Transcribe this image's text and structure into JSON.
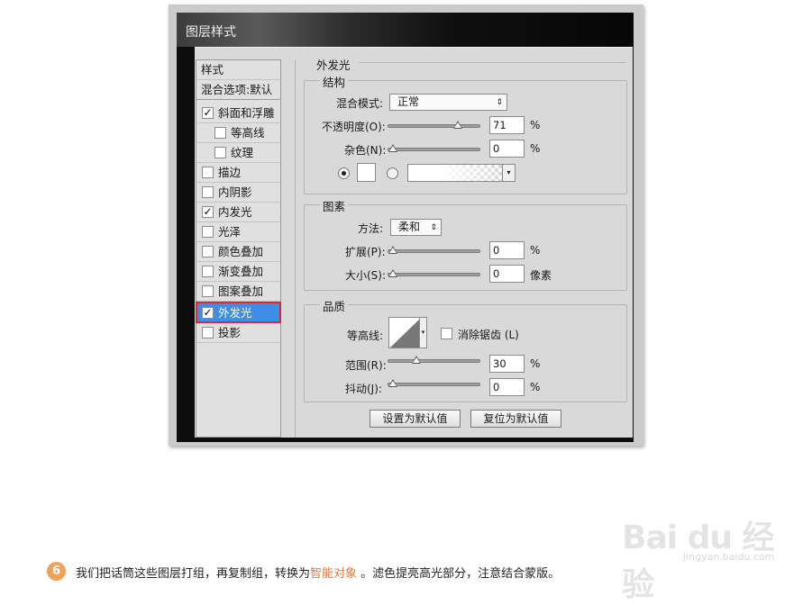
{
  "dialog": {
    "title": "图层样式"
  },
  "styles": {
    "header": "样式",
    "blend": "混合选项:默认",
    "items": [
      {
        "label": "斜面和浮雕",
        "checked": true
      },
      {
        "label": "等高线",
        "checked": false
      },
      {
        "label": "纹理",
        "checked": false
      },
      {
        "label": "描边",
        "checked": false
      },
      {
        "label": "内阴影",
        "checked": false
      },
      {
        "label": "内发光",
        "checked": true
      },
      {
        "label": "光泽",
        "checked": false
      },
      {
        "label": "颜色叠加",
        "checked": false
      },
      {
        "label": "渐变叠加",
        "checked": false
      },
      {
        "label": "图案叠加",
        "checked": false
      },
      {
        "label": "外发光",
        "checked": true
      },
      {
        "label": "投影",
        "checked": false
      }
    ]
  },
  "panel": {
    "title": "外发光",
    "structure": {
      "label": "结构",
      "blend_mode_label": "混合模式:",
      "blend_mode_value": "正常",
      "opacity_label": "不透明度(O):",
      "opacity_value": "71",
      "opacity_unit": "%",
      "noise_label": "杂色(N):",
      "noise_value": "0",
      "noise_unit": "%"
    },
    "elements": {
      "label": "图素",
      "method_label": "方法:",
      "method_value": "柔和",
      "spread_label": "扩展(P):",
      "spread_value": "0",
      "spread_unit": "%",
      "size_label": "大小(S):",
      "size_value": "0",
      "size_unit": "像素"
    },
    "quality": {
      "label": "品质",
      "contour_label": "等高线:",
      "antialias_label": "消除锯齿 (L)",
      "range_label": "范围(R):",
      "range_value": "30",
      "range_unit": "%",
      "jitter_label": "抖动(J):",
      "jitter_value": "0",
      "jitter_unit": "%"
    },
    "buttons": {
      "make_default": "设置为默认值",
      "reset_default": "复位为默认值"
    }
  },
  "footer": {
    "step": "6",
    "text_before": "我们把话筒这些图层打组，再复制组，转换为",
    "highlight": "智能对象",
    "text_after": " 。滤色提亮高光部分，注意结合蒙版。"
  },
  "watermark": {
    "logo": "Bai du 经验",
    "url": "jingyan.baidu.com"
  },
  "colors": {
    "selected": "#3d8ee6",
    "highlight": "#e8793a",
    "step": "#f0a25a"
  }
}
